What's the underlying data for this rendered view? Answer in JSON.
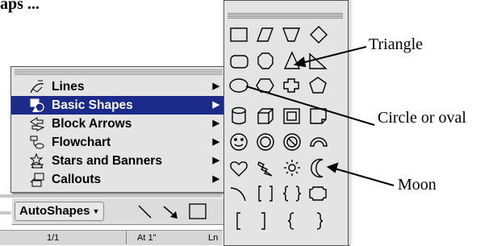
{
  "heading_fragment": "aps ...",
  "menu": {
    "items": [
      {
        "label": "Lines",
        "icon": "lines-icon",
        "selected": false
      },
      {
        "label": "Basic Shapes",
        "icon": "basic-shapes-icon",
        "selected": true
      },
      {
        "label": "Block Arrows",
        "icon": "block-arrows-icon",
        "selected": false
      },
      {
        "label": "Flowchart",
        "icon": "flowchart-icon",
        "selected": false
      },
      {
        "label": "Stars and Banners",
        "icon": "stars-and-banners-icon",
        "selected": false
      },
      {
        "label": "Callouts",
        "icon": "callouts-icon",
        "selected": false
      }
    ]
  },
  "toolbar": {
    "autoshapes_label": "AutoShapes",
    "dropdown_glyph": "▼"
  },
  "status_bar": {
    "page": "1/1",
    "at": "At 1\"",
    "ln": "Ln"
  },
  "palette": {
    "shapes": [
      "rectangle",
      "parallelogram",
      "trapezoid",
      "diamond",
      "rounded-rectangle",
      "octagon",
      "triangle",
      "right-triangle",
      "oval",
      "hexagon",
      "cross",
      "pentagon",
      "can",
      "cube",
      "frame",
      "folded-corner",
      "smiley-face",
      "donut",
      "no-symbol",
      "arc",
      "heart",
      "lightning-bolt",
      "sun",
      "moon",
      "corner-arc",
      "double-bracket",
      "double-brace",
      "plaque",
      "left-bracket",
      "right-bracket",
      "left-brace",
      "right-brace"
    ]
  },
  "callouts": {
    "triangle": "Triangle",
    "circle": "Circle or oval",
    "moon": "Moon"
  },
  "colors": {
    "selection": "#1c2b8a",
    "menu_bg": "#e4e4e4"
  }
}
